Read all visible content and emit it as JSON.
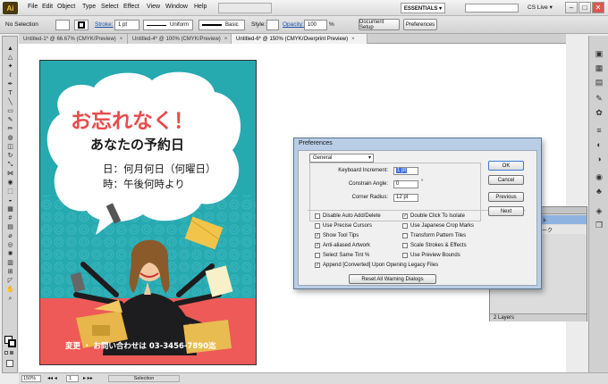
{
  "app": {
    "logo": "Ai",
    "workspace": "ESSENTIALS ▾",
    "cslive": "CS Live ▾",
    "win_min": "–",
    "win_max": "□",
    "win_close": "✕"
  },
  "menu": [
    "File",
    "Edit",
    "Object",
    "Type",
    "Select",
    "Effect",
    "View",
    "Window",
    "Help"
  ],
  "control": {
    "selection": "No Selection",
    "stroke_label": "Stroke:",
    "stroke_value": "1 pt",
    "profile": "Uniform",
    "brush": "Basic",
    "style_label": "Style:",
    "opacity_label": "Opacity:",
    "opacity_value": "100",
    "opacity_unit": "%",
    "doc_setup": "Document Setup",
    "preferences": "Preferences"
  },
  "tabs": [
    {
      "label": "Untitled-1* @ 66.67% (CMYK/Preview)"
    },
    {
      "label": "Untitled-4* @ 100% (CMYK/Preview)"
    },
    {
      "label": "Untitled-6* @ 150% (CMYK/Overprint Preview)"
    }
  ],
  "tab_close": "×",
  "poster": {
    "headline": "お忘れなく！",
    "subtitle": "あなたの予約日",
    "line1": "日：何月何日（何曜日）",
    "line2": "時：午後何時より",
    "footer": "変更 ・ お問い合わせは 03-3456-7890迄"
  },
  "colors": {
    "teal": "#27a9b0",
    "coral": "#ee5a57",
    "red_text": "#e84b4b"
  },
  "status": {
    "zoom": "150%",
    "page": "1",
    "mode": "Selection"
  },
  "dialog": {
    "title": "Preferences",
    "section": "General",
    "kb_label": "Keyboard Increment:",
    "kb_value": "1 pt",
    "angle_label": "Constrain Angle:",
    "angle_value": "0",
    "angle_unit": "°",
    "radius_label": "Corner Radius:",
    "radius_value": "12 pt",
    "ok": "OK",
    "cancel": "Cancel",
    "previous": "Previous",
    "next": "Next",
    "reset": "Reset All Warning Dialogs",
    "options_left": [
      {
        "label": "Disable Auto Add/Delete",
        "checked": false
      },
      {
        "label": "Use Precise Cursors",
        "checked": false
      },
      {
        "label": "Show Tool Tips",
        "checked": true
      },
      {
        "label": "Anti-aliased Artwork",
        "checked": true
      },
      {
        "label": "Select Same Tint %",
        "checked": false
      }
    ],
    "options_right": [
      {
        "label": "Double Click To Isolate",
        "checked": true
      },
      {
        "label": "Use Japanese Crop Marks",
        "checked": false
      },
      {
        "label": "Transform Pattern Tiles",
        "checked": false
      },
      {
        "label": "Scale Strokes & Effects",
        "checked": false
      },
      {
        "label": "Use Preview Bounds",
        "checked": false
      }
    ],
    "append": {
      "label": "Append [Converted] Upon Opening Legacy Files",
      "checked": true
    }
  },
  "layers": {
    "row1": "スト",
    "row2": "ワーク",
    "count": "2 Layers"
  }
}
